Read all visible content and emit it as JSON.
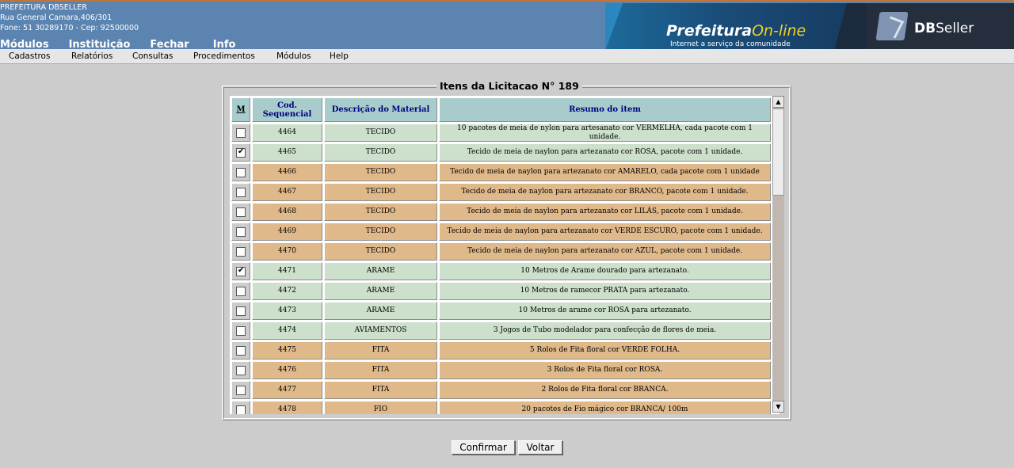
{
  "institution": {
    "name": "PREFEITURA DBSELLER",
    "address": "Rua General Camara,406/301",
    "phone": "Fone: 51 30289170  -  Cep: 92500000"
  },
  "topnav": [
    "Módulos",
    "Instituição",
    "Fechar",
    "Info"
  ],
  "banner": {
    "brand_main": "Prefeitura",
    "brand_accent": "On-line",
    "brand_tagline": "Internet a serviço da comunidade",
    "vendor_bold": "DB",
    "vendor_rest": "Seller"
  },
  "menubar": [
    "Cadastros",
    "Relatórios",
    "Consultas",
    "Procedimentos",
    "Módulos",
    "Help"
  ],
  "panel": {
    "title": "Itens da Licitacao N° 189"
  },
  "table": {
    "headers": {
      "mark": "M",
      "code": "Cod. Sequencial",
      "material": "Descrição do Material",
      "summary": "Resumo do item"
    },
    "rows": [
      {
        "checked": false,
        "code": "4464",
        "material": "TECIDO",
        "summary": "10 pacotes de meia de nylon para artesanato cor VERMELHA, cada pacote com 1 unidade.",
        "color": "green"
      },
      {
        "checked": true,
        "code": "4465",
        "material": "TECIDO",
        "summary": "Tecido de meia de naylon para artezanato cor ROSA, pacote com 1 unidade.",
        "color": "green"
      },
      {
        "checked": false,
        "code": "4466",
        "material": "TECIDO",
        "summary": "Tecido de meia de naylon para artezanato cor AMARELO, cada pacote com 1 unidade",
        "color": "orange"
      },
      {
        "checked": false,
        "code": "4467",
        "material": "TECIDO",
        "summary": "Tecido de meia de naylon para artezanato cor BRANCO, pacote com 1 unidade.",
        "color": "orange"
      },
      {
        "checked": false,
        "code": "4468",
        "material": "TECIDO",
        "summary": "Tecido de meia de naylon para artezanato cor LILÁS, pacote com 1 unidade.",
        "color": "orange"
      },
      {
        "checked": false,
        "code": "4469",
        "material": "TECIDO",
        "summary": "Tecido de meia de naylon para artezanato cor VERDE ESCURO, pacote com 1 unidade.",
        "color": "orange"
      },
      {
        "checked": false,
        "code": "4470",
        "material": "TECIDO",
        "summary": "Tecido de meia de naylon para artezanato cor AZUL, pacote com 1 unidade.",
        "color": "orange"
      },
      {
        "checked": true,
        "code": "4471",
        "material": "ARAME",
        "summary": "10 Metros de Arame dourado para artezanato.",
        "color": "green"
      },
      {
        "checked": false,
        "code": "4472",
        "material": "ARAME",
        "summary": "10 Metros de ramecor PRATA para artezanato.",
        "color": "green"
      },
      {
        "checked": false,
        "code": "4473",
        "material": "ARAME",
        "summary": "10 Metros de arame cor ROSA para artezanato.",
        "color": "green"
      },
      {
        "checked": false,
        "code": "4474",
        "material": "AVIAMENTOS",
        "summary": "3 Jogos de Tubo modelador para confecção de flores de meia.",
        "color": "green"
      },
      {
        "checked": false,
        "code": "4475",
        "material": "FITA",
        "summary": "5 Rolos de Fita floral cor VERDE FOLHA.",
        "color": "orange"
      },
      {
        "checked": false,
        "code": "4476",
        "material": "FITA",
        "summary": "3 Rolos de Fita floral cor ROSA.",
        "color": "orange"
      },
      {
        "checked": false,
        "code": "4477",
        "material": "FITA",
        "summary": "2 Rolos de Fita floral cor BRANCA.",
        "color": "orange"
      },
      {
        "checked": false,
        "code": "4478",
        "material": "FIO",
        "summary": "20 pacotes de Fio mágico cor BRANCA/ 100m",
        "color": "orange"
      }
    ]
  },
  "colors": {
    "header_blue": "#5b84b1",
    "row_green": "#cce0cc",
    "row_orange": "#e0b98a",
    "table_header": "#a8cccc"
  },
  "buttons": {
    "confirm": "Confirmar",
    "back": "Voltar"
  },
  "icons": {
    "scroll_up": "▲",
    "scroll_down": "▼"
  }
}
